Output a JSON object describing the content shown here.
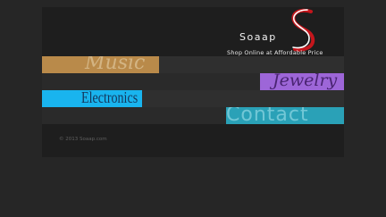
{
  "header": {
    "brand_name": "Soaap",
    "tagline": "Shop Online at Affordable Price",
    "logo_icon": "soaap-s-logo-icon"
  },
  "nav": {
    "items": [
      {
        "label": "Music",
        "color": "#b98a4a"
      },
      {
        "label": "Jewelry",
        "color": "#9d66d8"
      },
      {
        "label": "Electronics",
        "color": "#19b4ee"
      },
      {
        "label": "Contact",
        "color": "#2aa1b7"
      }
    ]
  },
  "footer": {
    "copyright": "© 2013 Soaap.com"
  },
  "colors": {
    "background": "#262626",
    "panel": "#1e1e1e",
    "logo_red": "#c4161c",
    "logo_white": "#ffffff"
  }
}
